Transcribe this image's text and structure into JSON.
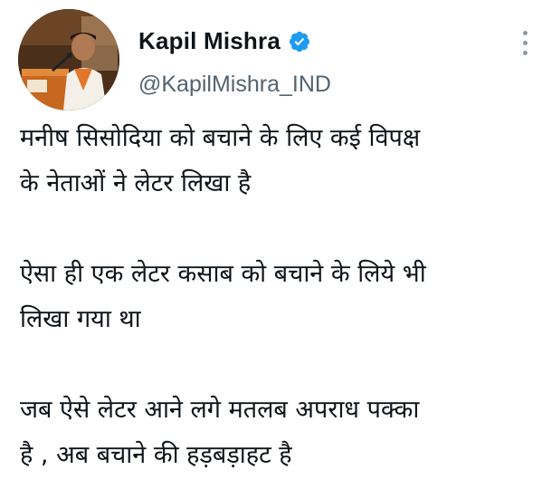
{
  "author": {
    "display_name": "Kapil Mishra",
    "handle": "@KapilMishra_IND",
    "verified": true,
    "verified_color": "#1d9bf0"
  },
  "tweet": {
    "paragraphs": [
      [
        "मनीष सिसोदिया को बचाने के लिए कई विपक्ष",
        "के नेताओं ने लेटर लिखा है"
      ],
      [
        "ऐसा ही एक लेटर कसाब को बचाने के लिये भी",
        "लिखा गया था"
      ],
      [
        "जब ऐसे लेटर आने लगे मतलब अपराध पक्का",
        "है , अब बचाने की हड़बड़ाहट है"
      ]
    ]
  },
  "icons": {
    "verified": "verified-badge-icon",
    "more": "more-options-icon"
  },
  "colors": {
    "text": "#0f1419",
    "secondary": "#536471",
    "background": "#ffffff"
  }
}
